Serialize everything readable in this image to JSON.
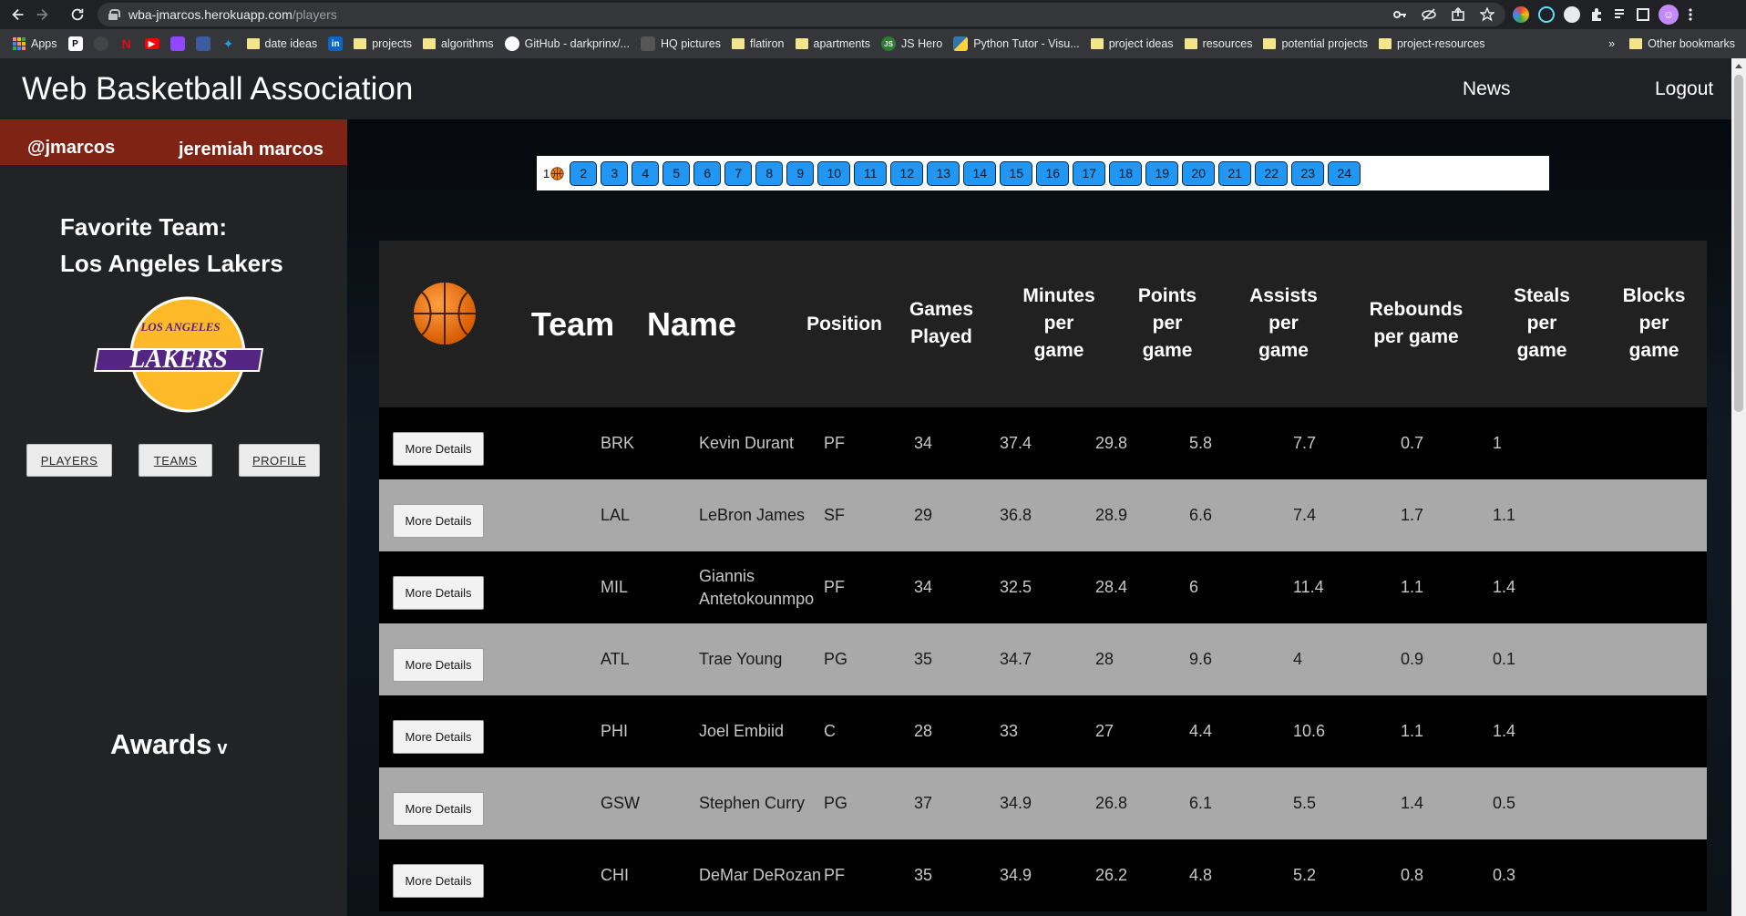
{
  "browser": {
    "url_host": "wba-jmarcos.herokuapp.com",
    "url_path": "/players",
    "bookmarks": [
      {
        "label": "Apps",
        "icon": "apps-grid-icon"
      },
      {
        "label": "",
        "icon": "pi-icon",
        "color": "#000000"
      },
      {
        "label": "",
        "icon": "github-icon",
        "color": "#444444"
      },
      {
        "label": "",
        "icon": "netflix-icon",
        "color": "#e50914"
      },
      {
        "label": "",
        "icon": "youtube-icon",
        "color": "#ff0000"
      },
      {
        "label": "",
        "icon": "twitch-icon",
        "color": "#9146ff"
      },
      {
        "label": "",
        "icon": "app-icon",
        "color": "#3a5ba0"
      },
      {
        "label": "",
        "icon": "twitter-icon",
        "color": "#1da1f2"
      },
      {
        "label": "date ideas",
        "icon": "folder-icon"
      },
      {
        "label": "",
        "icon": "linkedin-icon",
        "color": "#0a66c2"
      },
      {
        "label": "projects",
        "icon": "folder-icon"
      },
      {
        "label": "algorithms",
        "icon": "folder-icon"
      },
      {
        "label": "GitHub - darkprinx/...",
        "icon": "github-icon",
        "color": "#ffffff"
      },
      {
        "label": "HQ pictures",
        "icon": "image-icon",
        "color": "#555555"
      },
      {
        "label": "flatiron",
        "icon": "folder-icon"
      },
      {
        "label": "apartments",
        "icon": "folder-icon"
      },
      {
        "label": "JS Hero",
        "icon": "js-icon",
        "color": "#2e7d32"
      },
      {
        "label": "Python Tutor - Visu...",
        "icon": "python-icon",
        "color": "#3776ab"
      },
      {
        "label": "project ideas",
        "icon": "folder-icon"
      },
      {
        "label": "resources",
        "icon": "folder-icon"
      },
      {
        "label": "potential projects",
        "icon": "folder-icon"
      },
      {
        "label": "project-resources",
        "icon": "folder-icon"
      }
    ],
    "overflow": "»",
    "other_bookmarks": "Other bookmarks"
  },
  "header": {
    "title": "Web Basketball Association",
    "news": "News",
    "logout": "Logout"
  },
  "sidebar": {
    "handle": "@jmarcos",
    "fullname": "jeremiah marcos",
    "favorite_label": "Favorite Team:",
    "favorite_team": "Los Angeles Lakers",
    "logo_text_top": "LOS ANGELES",
    "logo_text_main": "LAKERS",
    "buttons": {
      "players": "PLAYERS",
      "teams": "TEAMS",
      "profile": "PROFILE"
    },
    "awards": "Awards",
    "awards_chevron": "v"
  },
  "pagination": {
    "current": "1",
    "pages": [
      "2",
      "3",
      "4",
      "5",
      "6",
      "7",
      "8",
      "9",
      "10",
      "11",
      "12",
      "13",
      "14",
      "15",
      "16",
      "17",
      "18",
      "19",
      "20",
      "21",
      "22",
      "23",
      "24"
    ]
  },
  "table": {
    "headers": {
      "team": "Team",
      "name": "Name",
      "position": "Position",
      "games": [
        "Games",
        "Played"
      ],
      "minutes": [
        "Minutes",
        "per",
        "game"
      ],
      "points": [
        "Points",
        "per",
        "game"
      ],
      "assists": [
        "Assists",
        "per",
        "game"
      ],
      "rebounds": [
        "Rebounds",
        "per game"
      ],
      "steals": [
        "Steals",
        "per",
        "game"
      ],
      "blocks": [
        "Blocks",
        "per",
        "game"
      ]
    },
    "more_details_label": "More Details",
    "rows": [
      {
        "team": "BRK",
        "name": [
          "Kevin Durant"
        ],
        "pos": "PF",
        "gp": "34",
        "min": "37.4",
        "pts": "29.8",
        "ast": "5.8",
        "reb": "7.7",
        "stl": "0.7",
        "blk": "1"
      },
      {
        "team": "LAL",
        "name": [
          "LeBron James"
        ],
        "pos": "SF",
        "gp": "29",
        "min": "36.8",
        "pts": "28.9",
        "ast": "6.6",
        "reb": "7.4",
        "stl": "1.7",
        "blk": "1.1"
      },
      {
        "team": "MIL",
        "name": [
          "Giannis",
          "Antetokounmpo"
        ],
        "pos": "PF",
        "gp": "34",
        "min": "32.5",
        "pts": "28.4",
        "ast": "6",
        "reb": "11.4",
        "stl": "1.1",
        "blk": "1.4"
      },
      {
        "team": "ATL",
        "name": [
          "Trae Young"
        ],
        "pos": "PG",
        "gp": "35",
        "min": "34.7",
        "pts": "28",
        "ast": "9.6",
        "reb": "4",
        "stl": "0.9",
        "blk": "0.1"
      },
      {
        "team": "PHI",
        "name": [
          "Joel Embiid"
        ],
        "pos": "C",
        "gp": "28",
        "min": "33",
        "pts": "27",
        "ast": "4.4",
        "reb": "10.6",
        "stl": "1.1",
        "blk": "1.4"
      },
      {
        "team": "GSW",
        "name": [
          "Stephen Curry"
        ],
        "pos": "PG",
        "gp": "37",
        "min": "34.9",
        "pts": "26.8",
        "ast": "6.1",
        "reb": "5.5",
        "stl": "1.4",
        "blk": "0.5"
      },
      {
        "team": "CHI",
        "name": [
          "DeMar DeRozan"
        ],
        "pos": "PF",
        "gp": "35",
        "min": "34.9",
        "pts": "26.2",
        "ast": "4.8",
        "reb": "5.2",
        "stl": "0.8",
        "blk": "0.3"
      }
    ]
  },
  "colors": {
    "page_bg": "#202124",
    "user_bar": "#7f2315",
    "page_button": "#2196f3",
    "row_dark": "#000000",
    "row_light": "#a9a9a9",
    "lakers_purple": "#552583",
    "lakers_gold": "#fdb927",
    "ball_orange": "#f57f17"
  }
}
